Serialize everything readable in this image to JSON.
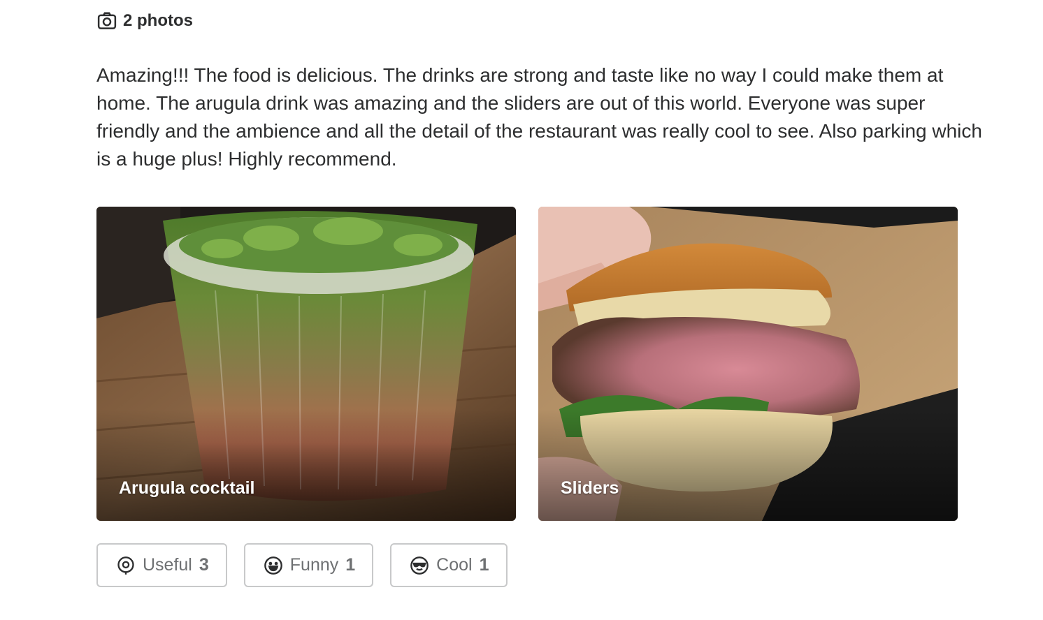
{
  "photos_header": {
    "icon": "camera-icon",
    "label": "2 photos"
  },
  "review": {
    "text": "Amazing!!! The food is delicious. The drinks are strong and taste like no way I could make them at home. The arugula drink was amazing and the sliders are out of this world. Everyone was super friendly and the ambience and all the detail of the restaurant was really cool to see. Also parking which is a huge plus! Highly recommend."
  },
  "photos": [
    {
      "caption": "Arugula cocktail",
      "subject": "green arugula cocktail in a ribbed glass on a wooden table"
    },
    {
      "caption": "Sliders",
      "subject": "hand holding a bitten slider with pink medium-rare patty and arugula"
    }
  ],
  "reactions": [
    {
      "icon": "lightbulb-icon",
      "label": "Useful",
      "count": "3"
    },
    {
      "icon": "laughing-face-icon",
      "label": "Funny",
      "count": "1"
    },
    {
      "icon": "sunglasses-face-icon",
      "label": "Cool",
      "count": "1"
    }
  ],
  "colors": {
    "text": "#2d2e2f",
    "muted": "#6e7072",
    "border": "#c8c9ca"
  }
}
